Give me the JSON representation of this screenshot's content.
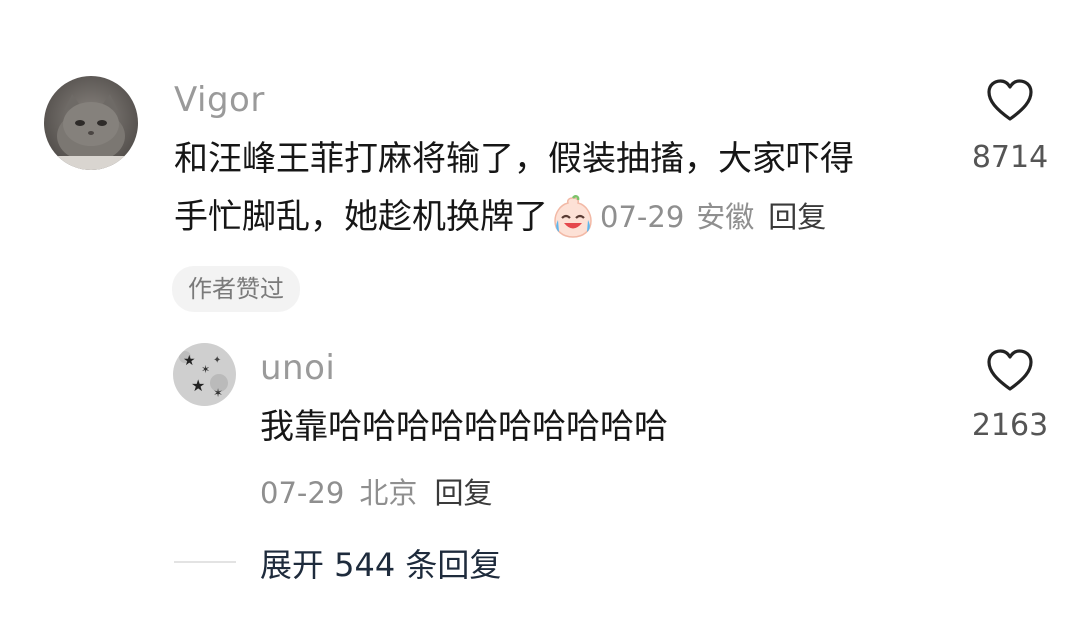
{
  "comment": {
    "username": "Vigor",
    "text_line1": "和汪峰王菲打麻将输了，假装抽搐，大家吓得",
    "text_line2": "手忙脚乱，她趁机换牌了",
    "emoji": "crying-laughing-emoji",
    "date": "07-29",
    "location": "安徽",
    "reply_label": "回复",
    "likes": "8714",
    "author_badge": "作者赞过"
  },
  "reply": {
    "username": "unoi",
    "text": "我靠哈哈哈哈哈哈哈哈哈哈",
    "date": "07-29",
    "location": "北京",
    "reply_label": "回复",
    "likes": "2163"
  },
  "expand": {
    "label": "展开 544 条回复"
  },
  "icons": {
    "like": "heart-outline-icon"
  }
}
